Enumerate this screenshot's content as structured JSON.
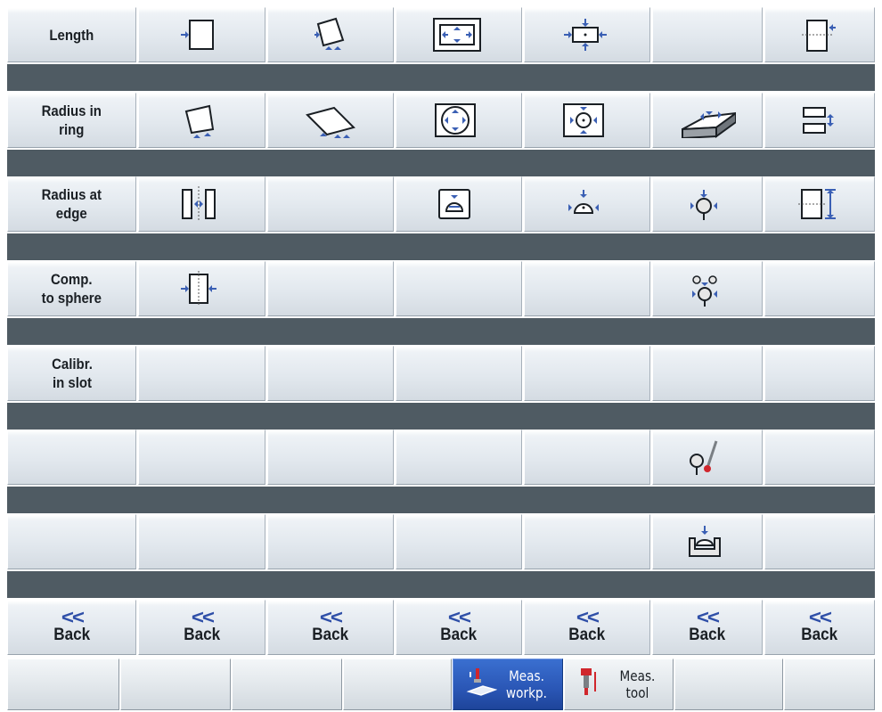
{
  "rows": [
    {
      "keys": [
        {
          "label": "Length",
          "icon": "measure-edge-icon"
        },
        {
          "icon": "rectangle-icon"
        },
        {
          "icon": "rotated-rectangle-icon"
        },
        {
          "icon": "rectangular-pocket-icon"
        },
        {
          "icon": "rectangular-spigot-icon"
        },
        {},
        {
          "icon": "slot-length-icon"
        }
      ]
    },
    {
      "keys": [
        {
          "label": "Radius in\nring",
          "icon": "radius-ring-icon"
        },
        {
          "icon": "angled-corner-icon"
        },
        {
          "icon": "parallelogram-icon"
        },
        {
          "icon": "circular-pocket-icon"
        },
        {
          "icon": "circular-spigot-icon"
        },
        {
          "icon": "inclined-plane-icon"
        },
        {
          "icon": "web-thickness-icon"
        }
      ]
    },
    {
      "keys": [
        {
          "label": "Radius at\nedge",
          "icon": "radius-edge-icon"
        },
        {
          "icon": "groove-width-icon"
        },
        {},
        {
          "icon": "spindle-probe-box-icon"
        },
        {
          "icon": "dome-icon"
        },
        {
          "icon": "sphere-probe-icon"
        },
        {
          "icon": "height-gauge-icon"
        }
      ]
    },
    {
      "keys": [
        {
          "label": "Comp.\nto sphere",
          "icon": "comp-sphere-icon"
        },
        {
          "icon": "slot-gap-icon"
        },
        {},
        {},
        {},
        {
          "icon": "three-sphere-icon"
        },
        {}
      ]
    },
    {
      "keys": [
        {
          "label": "Calibr.\nin slot",
          "icon": "calibr-slot-icon"
        },
        {},
        {},
        {},
        {},
        {},
        {}
      ]
    },
    {
      "keys": [
        {},
        {},
        {},
        {},
        {},
        {
          "icon": "probe-stylus-icon"
        },
        {}
      ]
    },
    {
      "keys": [
        {},
        {},
        {},
        {},
        {},
        {
          "icon": "probe-holder-icon"
        },
        {}
      ]
    }
  ],
  "back": {
    "chevron": "<<",
    "label": "Back",
    "count": 7
  },
  "hbar": [
    {
      "label": ""
    },
    {
      "label": ""
    },
    {
      "label": ""
    },
    {
      "label": ""
    },
    {
      "label": "Meas.\nworkp.",
      "icon": "measure-workpiece-icon",
      "active": true
    },
    {
      "label": "Meas.\ntool",
      "icon": "measure-tool-icon"
    },
    {
      "label": ""
    },
    {
      "label": ""
    }
  ],
  "colors": {
    "accent": "#3a6fd0",
    "separator": "#4f5b63",
    "arrow": "#3a5fb4"
  }
}
